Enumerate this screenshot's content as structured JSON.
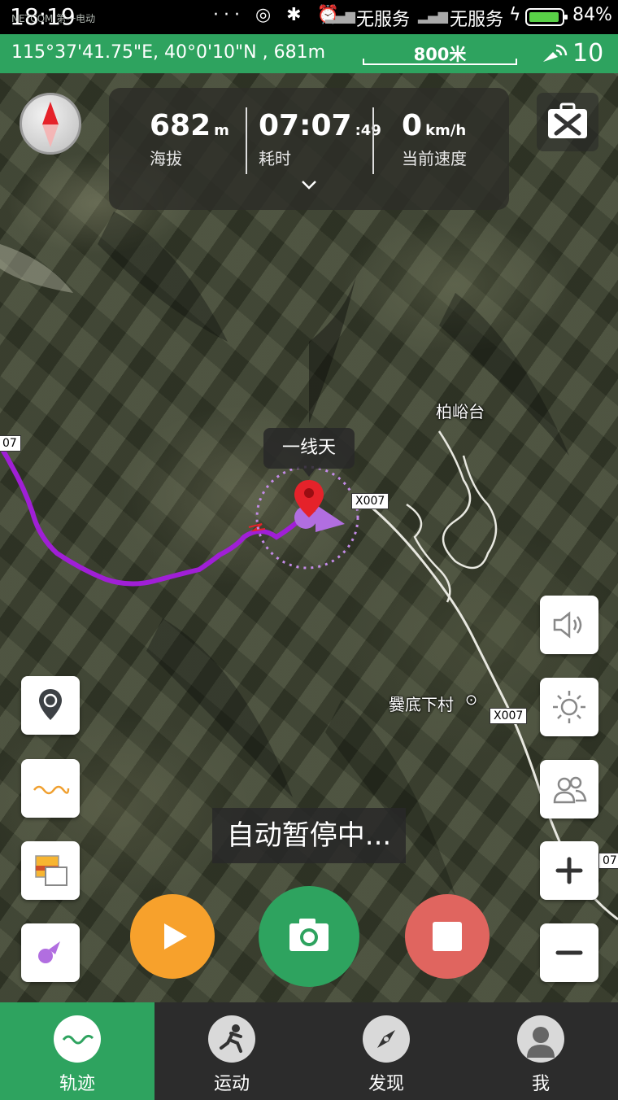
{
  "status_bar": {
    "time": "18:19",
    "carrier": "NETCOM 第一电动",
    "icons_text": "···",
    "service_1": "无服务",
    "service_2": "无服务",
    "battery_pct": "84%"
  },
  "gps_bar": {
    "coordinates": "115°37'41.75\"E, 40°0'10\"N , 681m",
    "scale_label": "800米",
    "satellite_count": "10"
  },
  "stats": {
    "altitude_value": "682",
    "altitude_unit": "m",
    "altitude_label": "海拔",
    "time_main": "07:07",
    "time_seconds": ":49",
    "time_label": "耗时",
    "speed_value": "0",
    "speed_unit": "km/h",
    "speed_label": "当前速度"
  },
  "map": {
    "poi_tooltip": "一线天",
    "place_1": "柏峪台",
    "place_2": "爨底下村",
    "road_labels": [
      "X007",
      "X007",
      "07",
      "07"
    ]
  },
  "pause_message": "自动暂停中...",
  "tabs": [
    {
      "label": "轨迹",
      "icon": "track-wave-icon"
    },
    {
      "label": "运动",
      "icon": "runner-icon"
    },
    {
      "label": "发现",
      "icon": "compass-icon"
    },
    {
      "label": "我",
      "icon": "profile-icon"
    }
  ],
  "colors": {
    "brand_green": "#2ea35f",
    "track_purple": "#a01fd6",
    "play_orange": "#f7a12c",
    "stop_red": "#e0655f",
    "marker_red": "#e5222a"
  }
}
